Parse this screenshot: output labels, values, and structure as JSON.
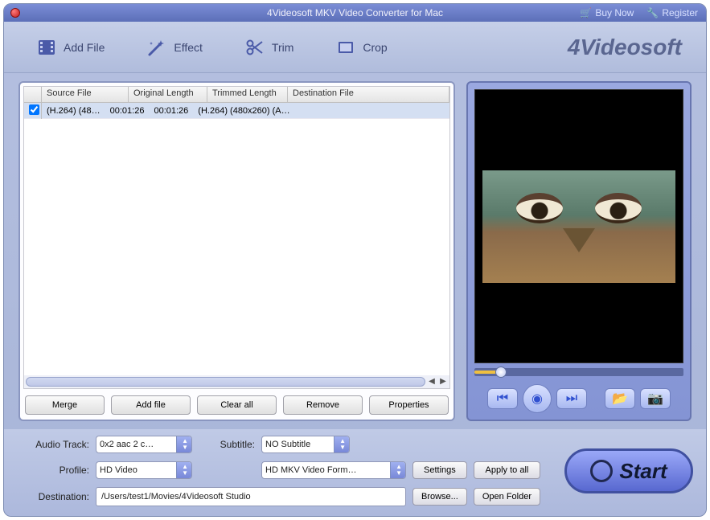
{
  "title": "4Videosoft MKV Video Converter for Mac",
  "header_links": {
    "buy": "Buy Now",
    "register": "Register"
  },
  "toolbar": {
    "add_file": "Add File",
    "effect": "Effect",
    "trim": "Trim",
    "crop": "Crop"
  },
  "brand": "4Videosoft",
  "table": {
    "headers": {
      "source": "Source File",
      "orig_len": "Original Length",
      "trim_len": "Trimmed Length",
      "dest": "Destination File"
    },
    "rows": [
      {
        "checked": true,
        "source": "(H.264) (48…",
        "orig_len": "00:01:26",
        "trim_len": "00:01:26",
        "dest": "(H.264) (480x260)  (A…"
      }
    ]
  },
  "list_buttons": {
    "merge": "Merge",
    "add_file": "Add file",
    "clear_all": "Clear all",
    "remove": "Remove",
    "properties": "Properties"
  },
  "labels": {
    "audio_track": "Audio Track:",
    "subtitle": "Subtitle:",
    "profile": "Profile:",
    "destination": "Destination:"
  },
  "values": {
    "audio_track": "0x2 aac 2 c…",
    "subtitle": "NO Subtitle",
    "profile_category": "HD Video",
    "profile_format": "HD MKV Video Form…",
    "destination": "/Users/test1/Movies/4Videosoft Studio"
  },
  "buttons": {
    "settings": "Settings",
    "apply_all": "Apply to all",
    "browse": "Browse...",
    "open_folder": "Open Folder",
    "start": "Start"
  }
}
